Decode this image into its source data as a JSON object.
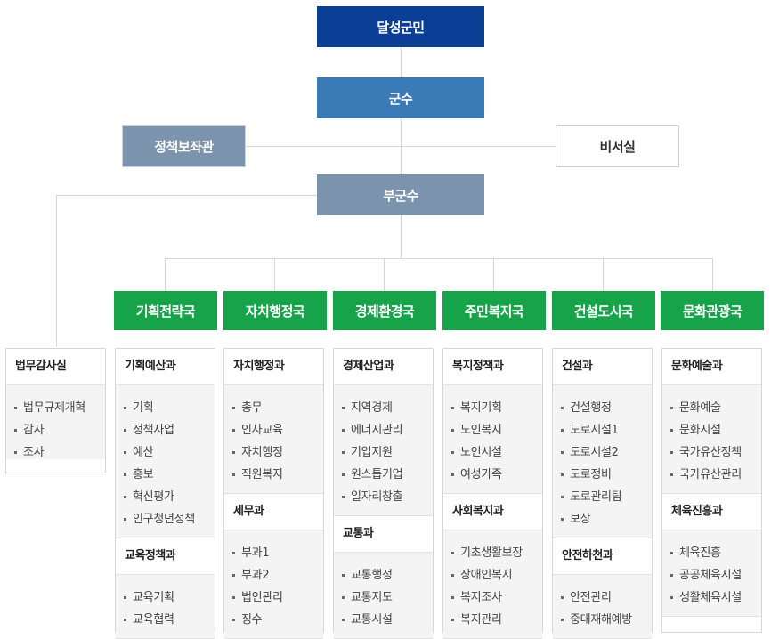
{
  "colors": {
    "top": "#0b3f96",
    "mayor": "#3a7ab6",
    "gray": "#7b93ad",
    "bureau": "#16a34a"
  },
  "top": {
    "label": "달성군민"
  },
  "mayor": {
    "label": "군수"
  },
  "policy_aide": {
    "label": "정책보좌관"
  },
  "secretary": {
    "label": "비서실"
  },
  "deputy": {
    "label": "부군수"
  },
  "legal_office": {
    "name": "법무감사실",
    "items": [
      "법무규제개혁",
      "감사",
      "조사"
    ]
  },
  "bureaus": [
    {
      "name": "기획전략국",
      "sections": [
        {
          "name": "기획예산과",
          "items": [
            "기획",
            "정책사업",
            "예산",
            "홍보",
            "혁신평가",
            "인구청년정책"
          ]
        },
        {
          "name": "교육정책과",
          "items": [
            "교육기획",
            "교육협력"
          ]
        }
      ]
    },
    {
      "name": "자치행정국",
      "sections": [
        {
          "name": "자치행정과",
          "items": [
            "총무",
            "인사교육",
            "자치행정",
            "직원복지"
          ]
        },
        {
          "name": "세무과",
          "items": [
            "부과1",
            "부과2",
            "법인관리",
            "징수"
          ]
        }
      ]
    },
    {
      "name": "경제환경국",
      "sections": [
        {
          "name": "경제산업과",
          "items": [
            "지역경제",
            "에너지관리",
            "기업지원",
            "원스톱기업",
            "일자리창출"
          ]
        },
        {
          "name": "교통과",
          "items": [
            "교통행정",
            "교통지도",
            "교통시설"
          ]
        }
      ]
    },
    {
      "name": "주민복지국",
      "sections": [
        {
          "name": "복지정책과",
          "items": [
            "복지기획",
            "노인복지",
            "노인시설",
            "여성가족"
          ]
        },
        {
          "name": "사회복지과",
          "items": [
            "기초생활보장",
            "장애인복지",
            "복지조사",
            "복지관리"
          ]
        }
      ]
    },
    {
      "name": "건설도시국",
      "sections": [
        {
          "name": "건설과",
          "items": [
            "건설행정",
            "도로시설1",
            "도로시설2",
            "도로정비",
            "도로관리팀",
            "보상"
          ]
        },
        {
          "name": "안전하천과",
          "items": [
            "안전관리",
            "중대재해예방"
          ]
        }
      ]
    },
    {
      "name": "문화관광국",
      "sections": [
        {
          "name": "문화예술과",
          "items": [
            "문화예술",
            "문화시설",
            "국가유산정책",
            "국가유산관리"
          ]
        },
        {
          "name": "체육진흥과",
          "items": [
            "체육진흥",
            "공공체육시설",
            "생활체육시설"
          ]
        }
      ]
    }
  ]
}
